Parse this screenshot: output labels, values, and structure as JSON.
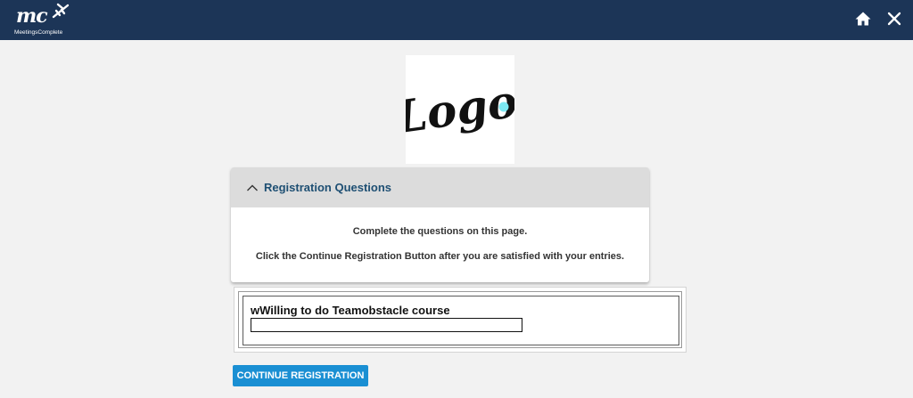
{
  "header": {
    "brand_mark": "mc",
    "brand_name": "MeetingsComplete",
    "home_icon": "home-icon",
    "close_icon": "close-icon",
    "background_color": "#1c3557"
  },
  "event_logo": {
    "text": "Logo",
    "dot_color": "#7de8f2"
  },
  "section": {
    "title": "Registration Questions",
    "expanded": true,
    "toggle_icon": "chevron-up-icon",
    "instructions": [
      "Complete the questions on this page.",
      "Click the Continue Registration Button after you are satisfied with your entries."
    ]
  },
  "question": {
    "label": "wWilling to do Teamobstacle course",
    "value": ""
  },
  "actions": {
    "continue_label": "CONTINUE REGISTRATION",
    "continue_color": "#1a8fd3"
  }
}
